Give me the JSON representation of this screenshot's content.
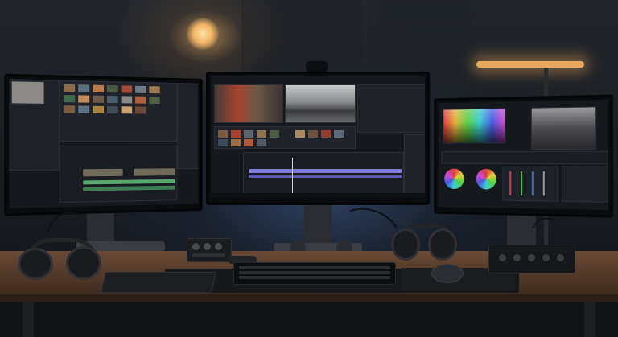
{
  "scene": {
    "colors": {
      "lamp_warm": "#f3b567",
      "backlight_blue": "#5a8cdc",
      "desk_wood": "#5a3e2d",
      "timeline_purple": "#7e7ad8",
      "timeline_green": "#5aa870"
    },
    "monitors": [
      "left-monitor",
      "center-monitor",
      "right-monitor"
    ],
    "icons": [
      "webcam-icon",
      "headphones-icon",
      "mouse-icon",
      "keyboard-icon",
      "desk-lamp-icon"
    ]
  }
}
